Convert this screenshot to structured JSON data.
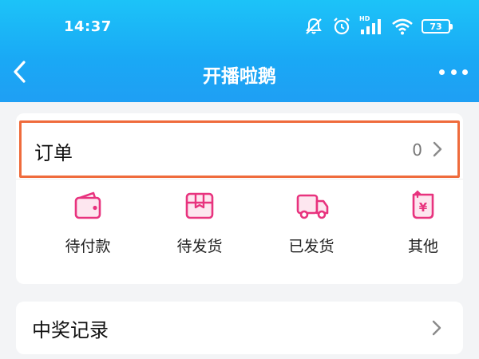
{
  "status_bar": {
    "time": "14:37",
    "icons": [
      "mute-icon",
      "alarm-icon",
      "signal-icon",
      "wifi-icon",
      "battery-icon"
    ],
    "hd_label": "HD",
    "battery_level": "73"
  },
  "nav": {
    "title": "开播啦鹅",
    "back_icon": "chevron-left-icon",
    "more_icon": "more-horizontal-icon"
  },
  "order": {
    "title": "订单",
    "count": "0",
    "items": [
      {
        "label": "待付款",
        "icon": "wallet-icon"
      },
      {
        "label": "待发货",
        "icon": "package-icon"
      },
      {
        "label": "已发货",
        "icon": "truck-icon"
      },
      {
        "label": "其他",
        "icon": "refund-icon"
      }
    ]
  },
  "prize": {
    "title": "中奖记录"
  },
  "colors": {
    "header_gradient_top": "#1cc3f8",
    "header_gradient_bottom": "#1f9ff4",
    "icon_accent": "#e8337e",
    "highlight_border": "#ef6b3c"
  }
}
